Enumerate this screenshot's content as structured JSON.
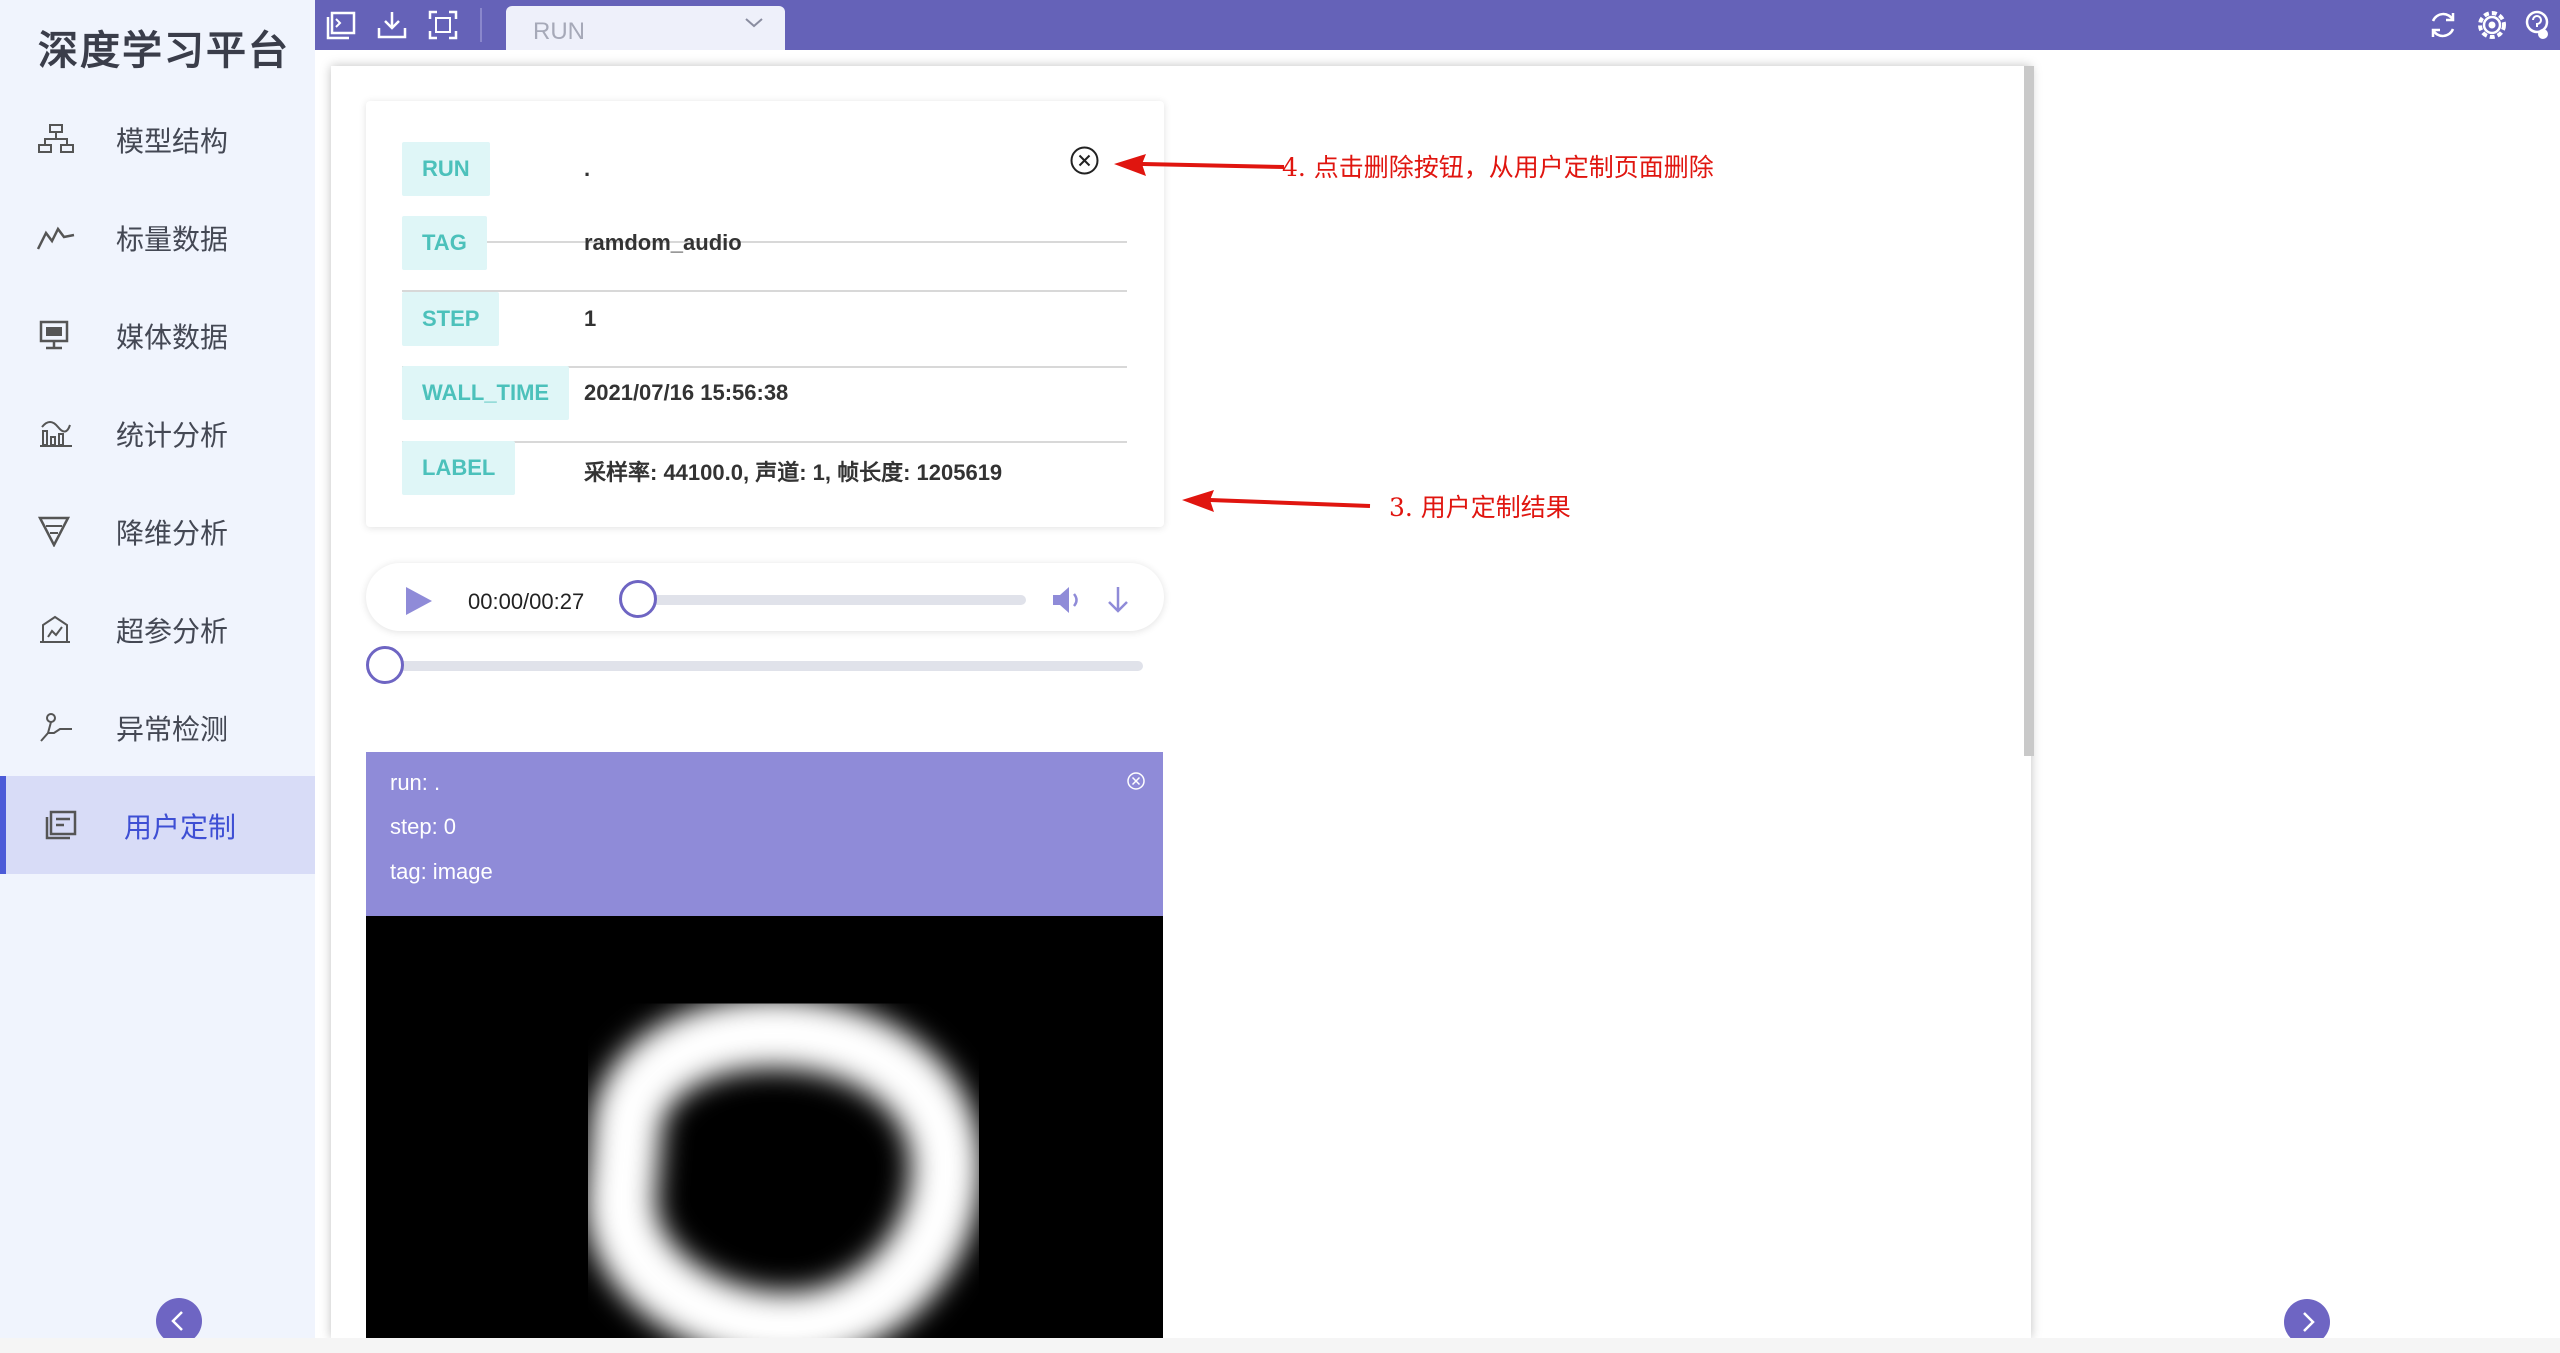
{
  "brand": "深度学习平台",
  "sidebar": {
    "items": [
      {
        "label": "模型结构",
        "icon": "model-structure-icon"
      },
      {
        "label": "标量数据",
        "icon": "scalar-chart-icon"
      },
      {
        "label": "媒体数据",
        "icon": "media-monitor-icon"
      },
      {
        "label": "统计分析",
        "icon": "statistics-icon"
      },
      {
        "label": "降维分析",
        "icon": "funnel-icon"
      },
      {
        "label": "超参分析",
        "icon": "hyperparam-icon"
      },
      {
        "label": "异常检测",
        "icon": "anomaly-icon"
      },
      {
        "label": "用户定制",
        "icon": "custom-icon",
        "active": true
      }
    ]
  },
  "topbar": {
    "run_select": {
      "placeholder": "RUN"
    }
  },
  "info": {
    "rows": [
      {
        "key": "RUN",
        "value": "."
      },
      {
        "key": "TAG",
        "value": "ramdom_audio"
      },
      {
        "key": "STEP",
        "value": "1"
      },
      {
        "key": "WALL_TIME",
        "value": "2021/07/16 15:56:38"
      },
      {
        "key": "LABEL",
        "value": "采样率: 44100.0, 声道: 1, 帧长度: 1205619"
      }
    ]
  },
  "player": {
    "time": "00:00/00:27",
    "progress": 0
  },
  "image_card": {
    "run": "run: .",
    "step": "step: 0",
    "tag": "tag: image"
  },
  "annotations": {
    "delete_hint": "4. 点击删除按钮，从用户定制页面删除",
    "result_hint": "3. 用户定制结果"
  },
  "colors": {
    "topbar": "#6562b8",
    "accent": "#6e65c3",
    "sidebar_bg": "#f0f4fd",
    "key_bg": "#dff6f7",
    "key_text": "#4cc1bb",
    "image_header": "#8f8bd8",
    "annotation": "#e0150f"
  }
}
